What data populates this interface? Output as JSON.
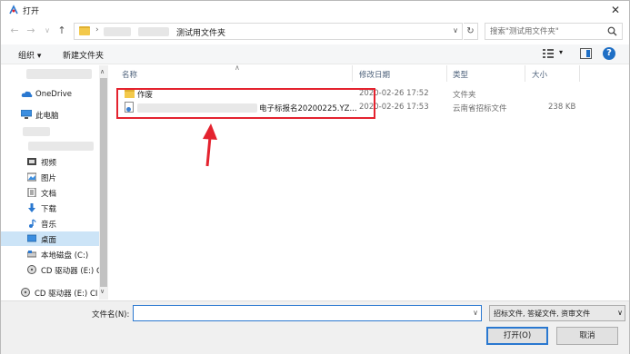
{
  "window": {
    "title": "打开",
    "close_glyph": "✕"
  },
  "address": {
    "back_glyph": "←",
    "forward_glyph": "→",
    "dropdown_glyph": "∨",
    "up_glyph": "↑",
    "separator": "›",
    "current_folder": "测试用文件夹",
    "addr_dropdown": "∨",
    "refresh_glyph": "↻"
  },
  "search": {
    "placeholder": "搜索\"测试用文件夹\""
  },
  "toolbar": {
    "organize_label": "组织 ▾",
    "new_folder_label": "新建文件夹",
    "view_dropdown": "▾",
    "help_glyph": "?"
  },
  "sidebar": {
    "items": [
      {
        "label": "OneDrive"
      },
      {
        "label": "此电脑"
      },
      {
        "label": "视频"
      },
      {
        "label": "图片"
      },
      {
        "label": "文档"
      },
      {
        "label": "下载"
      },
      {
        "label": "音乐"
      },
      {
        "label": "桌面"
      },
      {
        "label": "本地磁盘 (C:)"
      },
      {
        "label": "CD 驱动器 (E:) C"
      },
      {
        "label": "CD 驱动器 (E:) CI"
      }
    ],
    "scroll_up": "∧",
    "scroll_down": "∨"
  },
  "columns": {
    "name": "名称",
    "sort_glyph": "∧",
    "modified": "修改日期",
    "type": "类型",
    "size": "大小"
  },
  "files": [
    {
      "name": "作废",
      "modified": "2020-02-26 17:52",
      "type": "文件夹",
      "size": ""
    },
    {
      "name": "电子标报名20200225.YZ...",
      "modified": "2020-02-26 17:53",
      "type": "云南省招标文件",
      "size": "238 KB"
    }
  ],
  "bottom": {
    "filename_label": "文件名(N):",
    "filename_value": "",
    "filename_dropdown": "∨",
    "filter_text": "招标文件, 答疑文件, 资审文件",
    "filter_dropdown": "∨",
    "open_label": "打开(O)",
    "cancel_label": "取消"
  },
  "colors": {
    "annotation_red": "#e4232f",
    "accent_blue": "#2a78d0",
    "selected_bg": "#cce4f7"
  }
}
